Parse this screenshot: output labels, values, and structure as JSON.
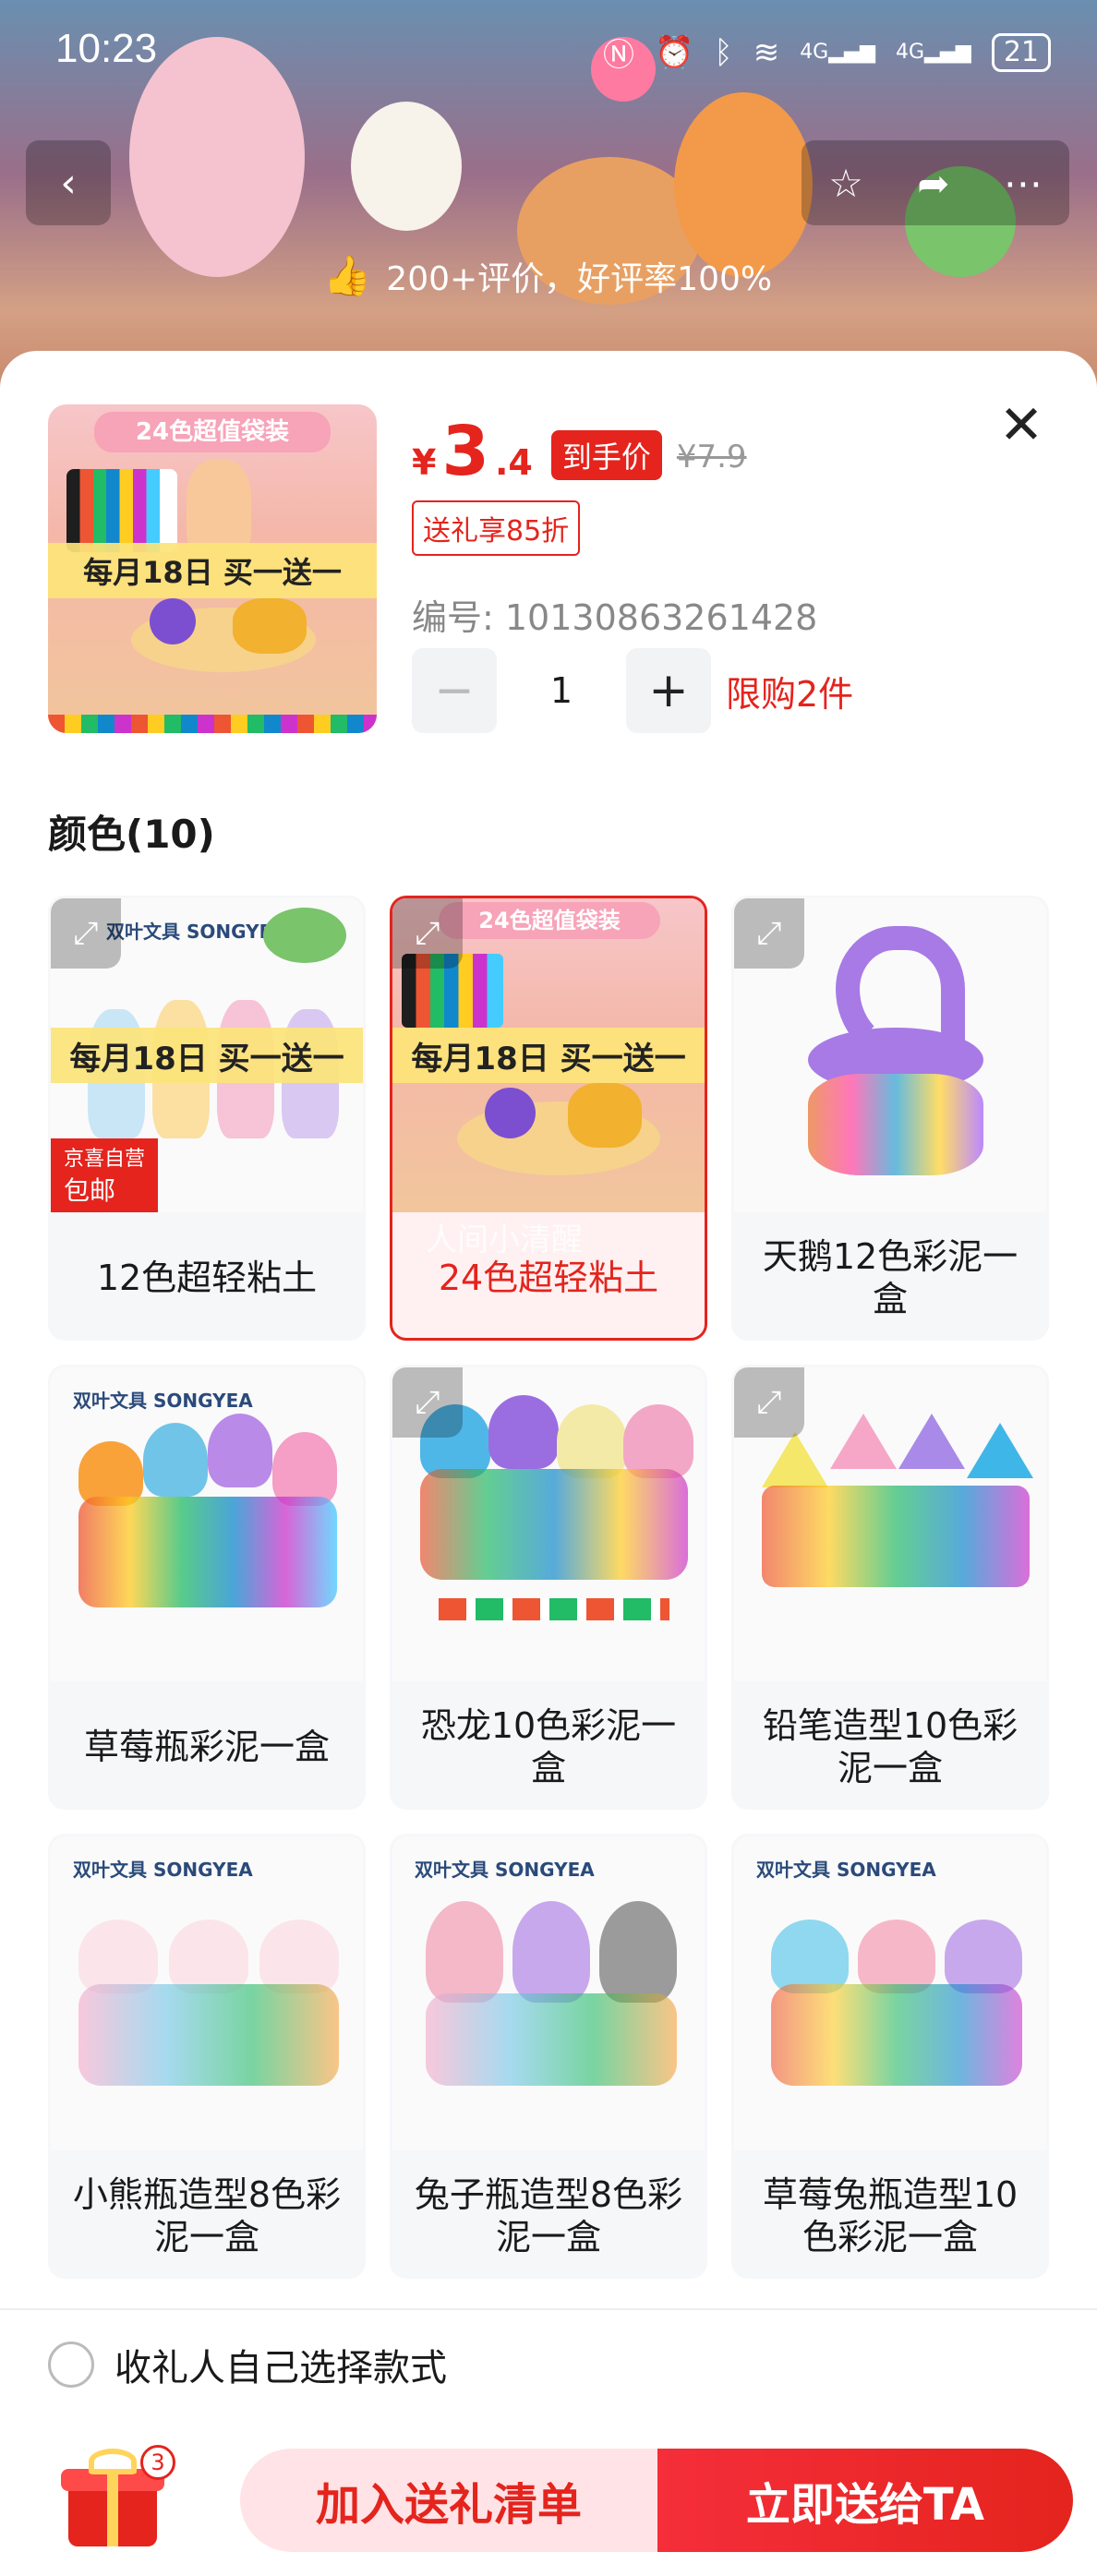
{
  "status": {
    "time": "10:23",
    "battery": "21",
    "network1": "4G",
    "network2": "4G"
  },
  "hero": {
    "rating_text": "200+评价，好评率100%"
  },
  "product": {
    "price_symbol": "¥",
    "price_int": "3",
    "price_dec": ".4",
    "price_tag": "到手价",
    "price_old": "¥7.9",
    "gift_discount": "送礼享85折",
    "sku_code": "编号: 10130863261428",
    "quantity": "1",
    "limit": "限购2件",
    "thumb_banner": "24色超值袋装",
    "thumb_promo": "每月18日 买一送一"
  },
  "section_title": "颜色(10)",
  "options": [
    {
      "label": "12色超轻粘土",
      "promo": "每月18日 买一送一",
      "ribbon1": "京喜自营",
      "ribbon2": "包邮",
      "brand": "双叶文具 SONGYEA",
      "selected": false
    },
    {
      "label": "24色超轻粘土",
      "promo": "每月18日 买一送一",
      "banner": "24色超值袋装",
      "watermark": "人间小清醒",
      "selected": true
    },
    {
      "label": "天鹅12色彩泥一盒",
      "selected": false
    },
    {
      "label": "草莓瓶彩泥一盒",
      "brand": "双叶文具 SONGYEA",
      "selected": false
    },
    {
      "label": "恐龙10色彩泥一盒",
      "selected": false
    },
    {
      "label": "铅笔造型10色彩泥一盒",
      "selected": false
    },
    {
      "label": "小熊瓶造型8色彩泥一盒",
      "brand": "双叶文具 SONGYEA",
      "selected": false
    },
    {
      "label": "兔子瓶造型8色彩泥一盒",
      "brand": "双叶文具 SONGYEA",
      "selected": false
    },
    {
      "label": "草莓兔瓶造型10色彩泥一盒",
      "brand": "双叶文具 SONGYEA",
      "selected": false
    }
  ],
  "bottom": {
    "self_pick": "收礼人自己选择款式",
    "gift_count": "3",
    "add_button": "加入送礼清单",
    "send_button": "立即送给TA"
  },
  "colors": {
    "accent": "#e4241d"
  }
}
